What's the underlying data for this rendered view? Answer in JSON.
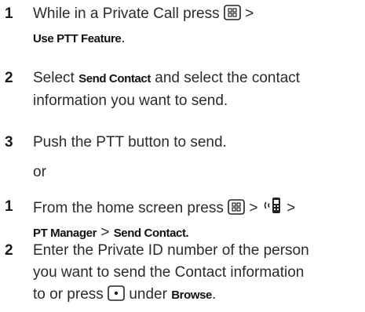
{
  "steps_a": [
    {
      "num": "1",
      "line1": "While in a Private Call press",
      "after_icon": " >",
      "line2": "Use PTT Feature",
      "line2_end": "."
    },
    {
      "num": "2",
      "pre": "Select ",
      "bold": "Send Contact",
      "post": " and select the contact",
      "line2": "information you want to send."
    },
    {
      "num": "3",
      "text": "Push the PTT button to send."
    }
  ],
  "or_text": "or",
  "steps_b": [
    {
      "num": "1",
      "line1": "From the home screen press",
      "sep1": " > ",
      "sep2": " >",
      "bold_a": "PT Manager",
      "sep3": " > ",
      "bold_b": "Send Contact."
    },
    {
      "num": "2",
      "line1": "Enter the Private ID number of the person",
      "line2": "you want to send the Contact information",
      "line3_pre": "to or press ",
      "line3_mid": " under ",
      "line3_bold": "Browse",
      "line3_end": "."
    }
  ],
  "icons": {
    "menu": "menu-key-icon",
    "ptt_phone": "ptt-phone-icon",
    "center": "center-select-key-icon"
  }
}
